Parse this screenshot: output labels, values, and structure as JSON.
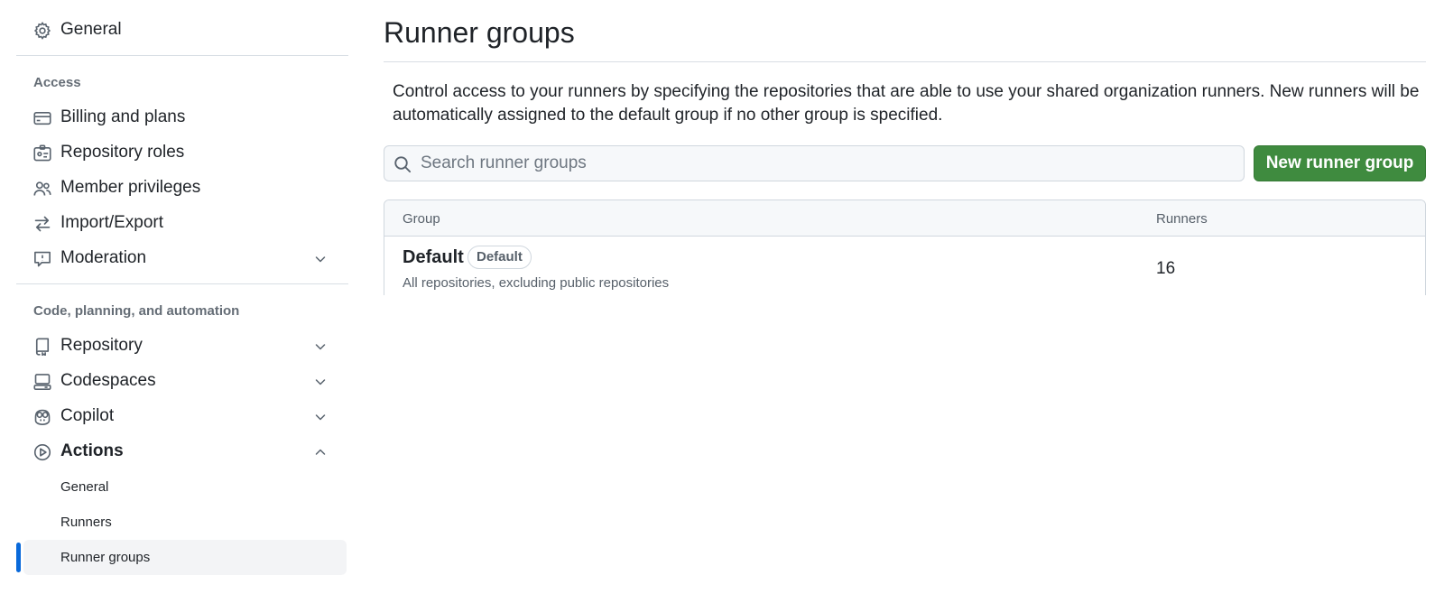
{
  "sidebar": {
    "general": {
      "label": "General",
      "icon": "gear-icon"
    },
    "access_heading": "Access",
    "access_items": [
      {
        "label": "Billing and plans",
        "icon": "credit-card-icon"
      },
      {
        "label": "Repository roles",
        "icon": "id-badge-icon"
      },
      {
        "label": "Member privileges",
        "icon": "people-icon"
      },
      {
        "label": "Import/Export",
        "icon": "arrow-switch-icon"
      },
      {
        "label": "Moderation",
        "icon": "report-icon",
        "expandable": true
      }
    ],
    "code_heading": "Code, planning, and automation",
    "code_items": [
      {
        "label": "Repository",
        "icon": "repo-icon",
        "expandable": true
      },
      {
        "label": "Codespaces",
        "icon": "codespaces-icon",
        "expandable": true
      },
      {
        "label": "Copilot",
        "icon": "copilot-icon",
        "expandable": true
      },
      {
        "label": "Actions",
        "icon": "play-icon",
        "expanded": true
      }
    ],
    "actions_sub_items": [
      {
        "label": "General"
      },
      {
        "label": "Runners"
      },
      {
        "label": "Runner groups",
        "active": true
      }
    ]
  },
  "main": {
    "title": "Runner groups",
    "description": "Control access to your runners by specifying the repositories that are able to use your shared organization runners. New runners will be automatically assigned to the default group if no other group is specified.",
    "search": {
      "placeholder": "Search runner groups",
      "value": ""
    },
    "new_button_label": "New runner group",
    "table": {
      "columns": [
        "Group",
        "Runners"
      ],
      "rows": [
        {
          "name": "Default",
          "badge": "Default",
          "description": "All repositories, excluding public repositories",
          "runners": "16"
        }
      ]
    }
  },
  "colors": {
    "accent_blue": "#0969da",
    "primary_button": "#3f8b3f",
    "text": "#1f2328",
    "muted_text": "#656d76",
    "border": "#d0d7de"
  }
}
